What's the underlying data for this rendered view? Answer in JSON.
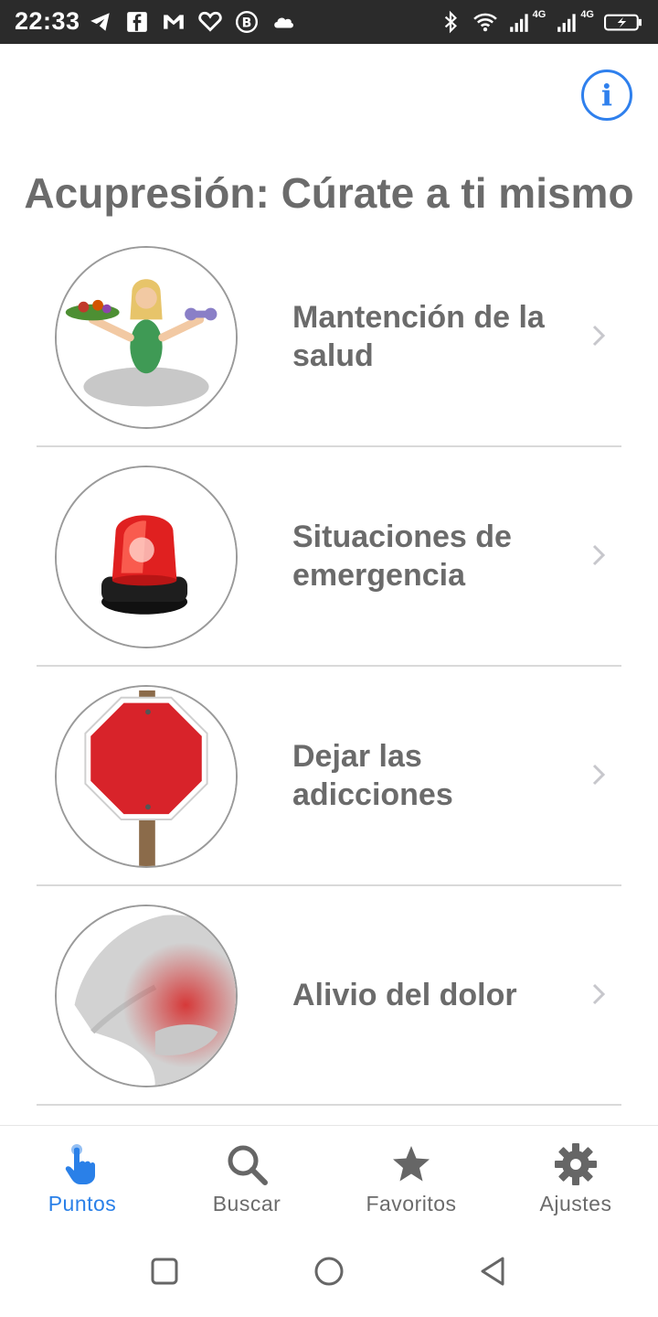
{
  "status_bar": {
    "time": "22:33",
    "left_icons": [
      "telegram-icon",
      "facebook-icon",
      "gmail-icon",
      "heart-icon",
      "b-circle-icon",
      "cloud-icon"
    ],
    "right_icons": [
      "bluetooth-icon",
      "wifi-icon",
      "signal-icon",
      "signal-icon",
      "battery-charging-icon"
    ],
    "network_labels": [
      "4G",
      "4G"
    ]
  },
  "header": {
    "info_icon": "info-icon",
    "title": "Acupresión: Cúrate a ti mismo"
  },
  "categories": [
    {
      "label": "Mantención de la salud",
      "image": "woman-yoga-healthy-food"
    },
    {
      "label": "Situaciones de emergencia",
      "image": "red-emergency-siren"
    },
    {
      "label": "Dejar las adicciones",
      "image": "stop-sign"
    },
    {
      "label": "Alivio del dolor",
      "image": "back-pain"
    }
  ],
  "tabs": [
    {
      "label": "Puntos",
      "icon": "pointing-hand-icon",
      "active": true
    },
    {
      "label": "Buscar",
      "icon": "search-icon",
      "active": false
    },
    {
      "label": "Favoritos",
      "icon": "star-icon",
      "active": false
    },
    {
      "label": "Ajustes",
      "icon": "gear-icon",
      "active": false
    }
  ],
  "colors": {
    "accent": "#2a80e8",
    "text": "#6b6b6b",
    "status_bar": "#2b2b2b"
  }
}
